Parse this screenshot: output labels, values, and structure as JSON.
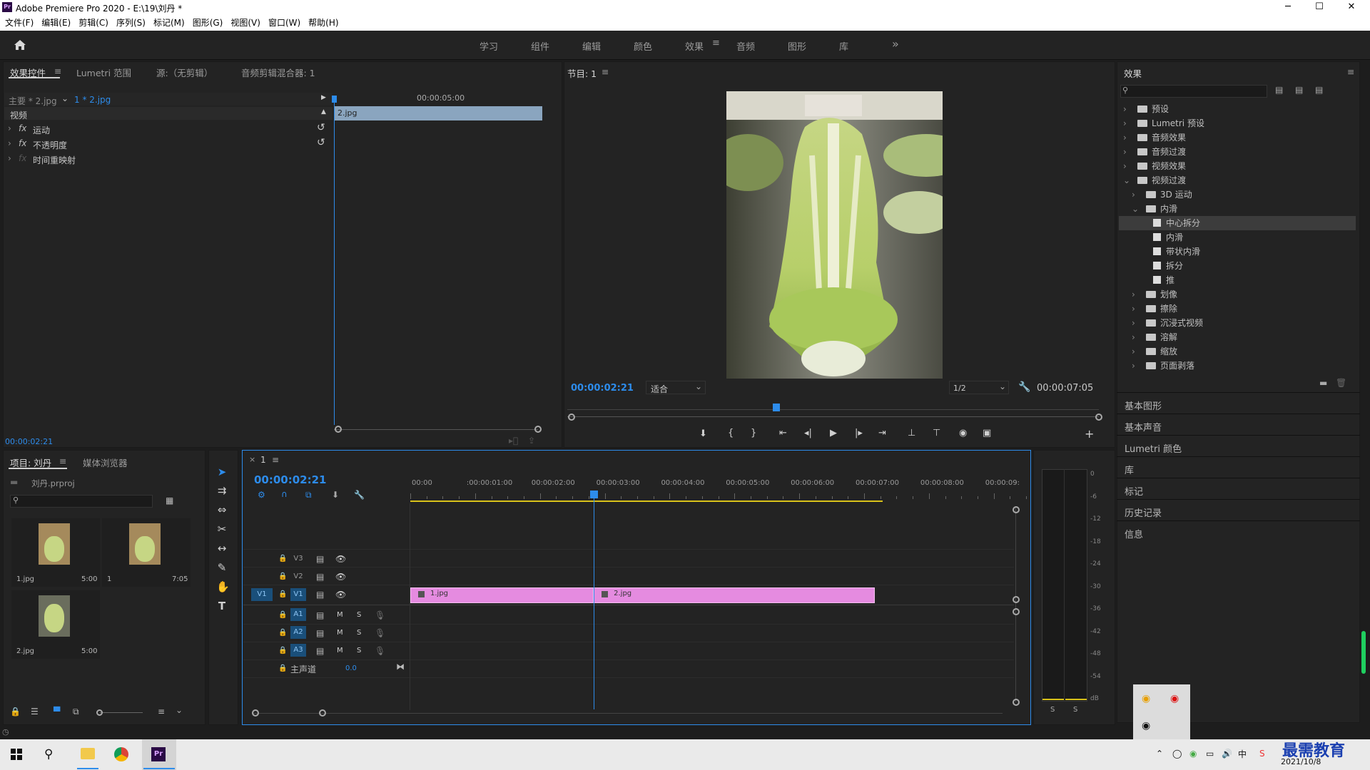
{
  "app": {
    "title": "Adobe Premiere Pro 2020 - E:\\19\\刘丹 *",
    "logo": "Pr"
  },
  "window_controls": {
    "minimize": "─",
    "maximize": "☐",
    "close": "✕"
  },
  "menu": [
    "文件(F)",
    "编辑(E)",
    "剪辑(C)",
    "序列(S)",
    "标记(M)",
    "图形(G)",
    "视图(V)",
    "窗口(W)",
    "帮助(H)"
  ],
  "workspaces": {
    "items": [
      "学习",
      "组件",
      "编辑",
      "颜色",
      "效果",
      "音频",
      "图形",
      "库"
    ],
    "active": "效果",
    "more": "»"
  },
  "effect_controls": {
    "tabs": [
      "效果控件",
      "Lumetri 范围",
      "源:（无剪辑）",
      "音频剪辑混合器: 1"
    ],
    "master": "主要 * 2.jpg",
    "clip": "1 * 2.jpg",
    "time_marker": "00:00:05:00",
    "clip_bar": "2.jpg",
    "section": "视频",
    "props": [
      "运动",
      "不透明度",
      "时间重映射"
    ],
    "fx": "fx",
    "timecode": "00:00:02:21"
  },
  "program": {
    "title": "节目: 1",
    "timecode": "00:00:02:21",
    "fit": "适合",
    "resolution": "1/2",
    "duration": "00:00:07:05"
  },
  "effects_panel": {
    "title": "效果",
    "tree": [
      {
        "label": "预设",
        "level": 0,
        "type": "folder",
        "expanded": false
      },
      {
        "label": "Lumetri 预设",
        "level": 0,
        "type": "folder",
        "expanded": false
      },
      {
        "label": "音频效果",
        "level": 0,
        "type": "folder",
        "expanded": false
      },
      {
        "label": "音频过渡",
        "level": 0,
        "type": "folder",
        "expanded": false
      },
      {
        "label": "视频效果",
        "level": 0,
        "type": "folder",
        "expanded": false
      },
      {
        "label": "视频过渡",
        "level": 0,
        "type": "folder",
        "expanded": true
      },
      {
        "label": "3D 运动",
        "level": 1,
        "type": "folder",
        "expanded": false
      },
      {
        "label": "内滑",
        "level": 1,
        "type": "folder",
        "expanded": true
      },
      {
        "label": "中心拆分",
        "level": 2,
        "type": "item",
        "selected": true
      },
      {
        "label": "内滑",
        "level": 2,
        "type": "item"
      },
      {
        "label": "带状内滑",
        "level": 2,
        "type": "item"
      },
      {
        "label": "拆分",
        "level": 2,
        "type": "item"
      },
      {
        "label": "推",
        "level": 2,
        "type": "item"
      },
      {
        "label": "划像",
        "level": 1,
        "type": "folder",
        "expanded": false
      },
      {
        "label": "擦除",
        "level": 1,
        "type": "folder",
        "expanded": false
      },
      {
        "label": "沉浸式视频",
        "level": 1,
        "type": "folder",
        "expanded": false
      },
      {
        "label": "溶解",
        "level": 1,
        "type": "folder",
        "expanded": false
      },
      {
        "label": "缩放",
        "level": 1,
        "type": "folder",
        "expanded": false
      },
      {
        "label": "页面剥落",
        "level": 1,
        "type": "folder",
        "expanded": false
      }
    ],
    "sections": [
      "基本图形",
      "基本声音",
      "Lumetri 颜色",
      "库",
      "标记",
      "历史记录",
      "信息"
    ]
  },
  "project": {
    "tabs": [
      "项目: 刘丹",
      "媒体浏览器"
    ],
    "file": "刘丹.prproj",
    "items": [
      {
        "name": "1.jpg",
        "dur": "5:00"
      },
      {
        "name": "1",
        "dur": "7:05"
      },
      {
        "name": "2.jpg",
        "dur": "5:00"
      }
    ]
  },
  "timeline": {
    "tab": "1",
    "timecode": "00:00:02:21",
    "ruler": [
      "00:00",
      ":00:00:01:00",
      "00:00:02:00",
      "00:00:03:00",
      "00:00:04:00",
      "00:00:05:00",
      "00:00:06:00",
      "00:00:07:00",
      "00:00:08:00",
      "00:00:09:"
    ],
    "video_tracks": [
      "V3",
      "V2",
      "V1"
    ],
    "source_v": "V1",
    "audio_tracks": [
      "A1",
      "A2",
      "A3"
    ],
    "master": "主声道",
    "master_val": "0.0",
    "clips": [
      {
        "name": "1.jpg",
        "start": 0.0,
        "end": 2.83
      },
      {
        "name": "2.jpg",
        "start": 2.83,
        "end": 7.17
      }
    ],
    "playhead": 2.83,
    "m": "M",
    "s": "S"
  },
  "meters": {
    "scale": [
      "0",
      "-6",
      "-12",
      "-18",
      "-24",
      "-30",
      "-36",
      "-42",
      "-48",
      "-54",
      "dB"
    ],
    "solo": [
      "S",
      "S"
    ]
  },
  "taskbar": {
    "date": "2021/10/8",
    "ime": "中",
    "watermark": "最需教育"
  },
  "colors": {
    "accent": "#2d8ceb",
    "clip": "#e58be0",
    "panel": "#232323",
    "bg": "#1d1d1d"
  }
}
